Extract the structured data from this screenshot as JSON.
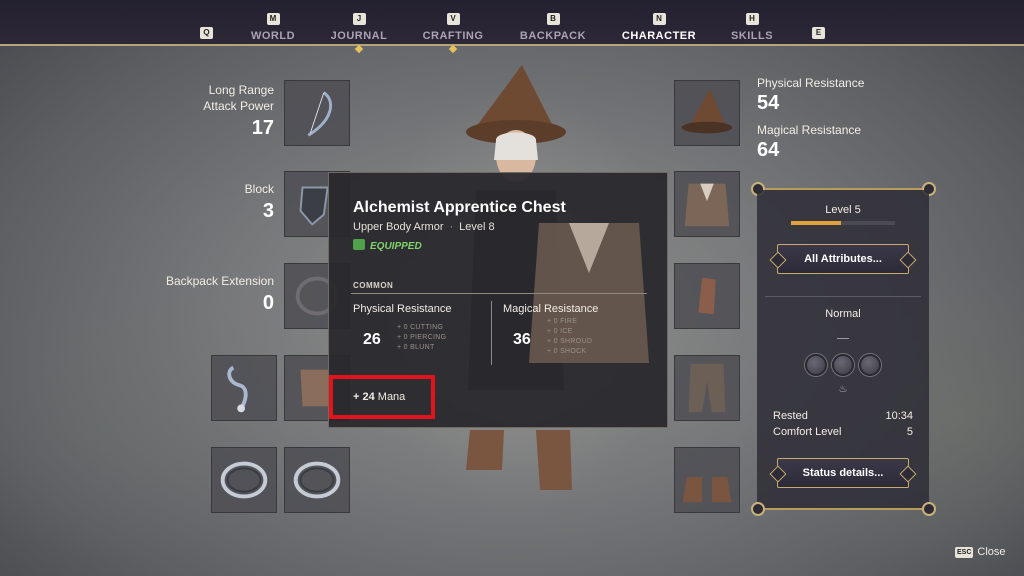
{
  "nav": {
    "left_key": "Q",
    "right_key": "E",
    "tabs": [
      {
        "key": "M",
        "label": "WORLD"
      },
      {
        "key": "J",
        "label": "JOURNAL"
      },
      {
        "key": "V",
        "label": "CRAFTING"
      },
      {
        "key": "B",
        "label": "BACKPACK"
      },
      {
        "key": "N",
        "label": "CHARACTER"
      },
      {
        "key": "H",
        "label": "SKILLS"
      }
    ],
    "active": "CHARACTER"
  },
  "left_stats": [
    {
      "label_line1": "Long Range",
      "label_line2": "Attack Power",
      "value": "17"
    },
    {
      "label_line1": "Block",
      "label_line2": "",
      "value": "3"
    },
    {
      "label_line1": "Backpack Extension",
      "label_line2": "",
      "value": "0"
    }
  ],
  "tooltip": {
    "title": "Alchemist Apprentice Chest",
    "type": "Upper Body Armor",
    "level": "Level 8",
    "equipped": "EQUIPPED",
    "rarity": "COMMON",
    "physical": {
      "title": "Physical Resistance",
      "value": "26",
      "subs": [
        "+ 0 CUTTING",
        "+ 0 PIERCING",
        "+ 0 BLUNT"
      ]
    },
    "magical": {
      "title": "Magical Resistance",
      "value": "36",
      "subs": [
        "+ 0 FIRE",
        "+ 0 ICE",
        "+ 0 SHROUD",
        "+ 0 SHOCK"
      ]
    },
    "bonus_value": "+ 24",
    "bonus_stat": "Mana"
  },
  "right_stats": {
    "physical_label": "Physical Resistance",
    "physical_value": "54",
    "magical_label": "Magical Resistance",
    "magical_value": "64"
  },
  "side_panel": {
    "level": "Level 5",
    "xp_progress": 0.48,
    "all_attributes_button": "All Attributes...",
    "difficulty_mode": "Normal",
    "status_label": "Rested",
    "status_value": "10:34",
    "comfort_label": "Comfort Level",
    "comfort_value": "5",
    "status_details_button": "Status details..."
  },
  "footer": {
    "close_key": "ESC",
    "close_label": "Close"
  },
  "colors": {
    "accent_gold": "#c6ad6e",
    "equipped_green": "#7ed36a",
    "highlight_red": "#e2131b",
    "xp_orange": "#e0a33b"
  }
}
